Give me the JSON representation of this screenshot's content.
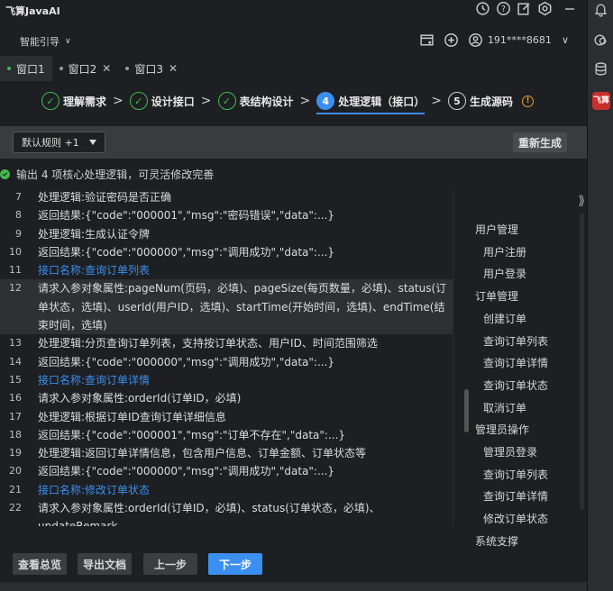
{
  "app": {
    "title": "飞算JavaAI"
  },
  "header": {
    "guide_label": "智能引导",
    "user_phone": "191****8681"
  },
  "tabs": [
    {
      "label": "窗口1"
    },
    {
      "label": "窗口2"
    },
    {
      "label": "窗口3"
    }
  ],
  "steps": [
    {
      "num": "✓",
      "label": "理解需求"
    },
    {
      "num": "✓",
      "label": "设计接口"
    },
    {
      "num": "✓",
      "label": "表结构设计"
    },
    {
      "num": "4",
      "label": "处理逻辑（接口）"
    },
    {
      "num": "5",
      "label": "生成源码"
    }
  ],
  "toolbar": {
    "rule_select": "默认规则 +1",
    "regenerate": "重新生成"
  },
  "status_text": "输出 4 项核心处理逻辑，可灵活修改完善",
  "lines": [
    {
      "n": "7",
      "t": "处理逻辑:验证密码是否正确"
    },
    {
      "n": "8",
      "t": "返回结果:{\"code\":\"000001\",\"msg\":\"密码错误\",\"data\":...}"
    },
    {
      "n": "9",
      "t": "处理逻辑:生成认证令牌"
    },
    {
      "n": "10",
      "t": "返回结果:{\"code\":\"000000\",\"msg\":\"调用成功\",\"data\":...}"
    },
    {
      "n": "11",
      "t": "接口名称:查询订单列表"
    },
    {
      "n": "12",
      "t": "请求入参对象属性:pageNum(页码，必填)、pageSize(每页数量，必填)、status(订单状态，选填)、userId(用户ID，选填)、startTime(开始时间，选填)、endTime(结束时间，选填)"
    },
    {
      "n": "13",
      "t": "处理逻辑:分页查询订单列表，支持按订单状态、用户ID、时间范围筛选"
    },
    {
      "n": "14",
      "t": "返回结果:{\"code\":\"000000\",\"msg\":\"调用成功\",\"data\":...}"
    },
    {
      "n": "15",
      "t": "接口名称:查询订单详情"
    },
    {
      "n": "16",
      "t": "请求入参对象属性:orderId(订单ID，必填)"
    },
    {
      "n": "17",
      "t": "处理逻辑:根据订单ID查询订单详细信息"
    },
    {
      "n": "18",
      "t": "返回结果:{\"code\":\"000001\",\"msg\":\"订单不存在\",\"data\":...}"
    },
    {
      "n": "19",
      "t": "处理逻辑:返回订单详情信息，包含用户信息、订单金额、订单状态等"
    },
    {
      "n": "20",
      "t": "返回结果:{\"code\":\"000000\",\"msg\":\"调用成功\",\"data\":...}"
    },
    {
      "n": "21",
      "t": "接口名称:修改订单状态"
    },
    {
      "n": "22",
      "t": "请求入参对象属性:orderId(订单ID，必填)、status(订单状态，必填)、updateRemark"
    }
  ],
  "outline": [
    {
      "label": "用户管理"
    },
    {
      "label": "用户注册"
    },
    {
      "label": "用户登录"
    },
    {
      "label": "订单管理"
    },
    {
      "label": "创建订单"
    },
    {
      "label": "查询订单列表"
    },
    {
      "label": "查询订单详情"
    },
    {
      "label": "查询订单状态"
    },
    {
      "label": "取消订单"
    },
    {
      "label": "管理员操作"
    },
    {
      "label": "管理员登录"
    },
    {
      "label": "查询订单列表"
    },
    {
      "label": "查询订单详情"
    },
    {
      "label": "修改订单状态"
    },
    {
      "label": "系统支撑"
    }
  ],
  "footer": {
    "overview": "查看总览",
    "export": "导出文档",
    "prev": "上一步",
    "next": "下一步"
  }
}
